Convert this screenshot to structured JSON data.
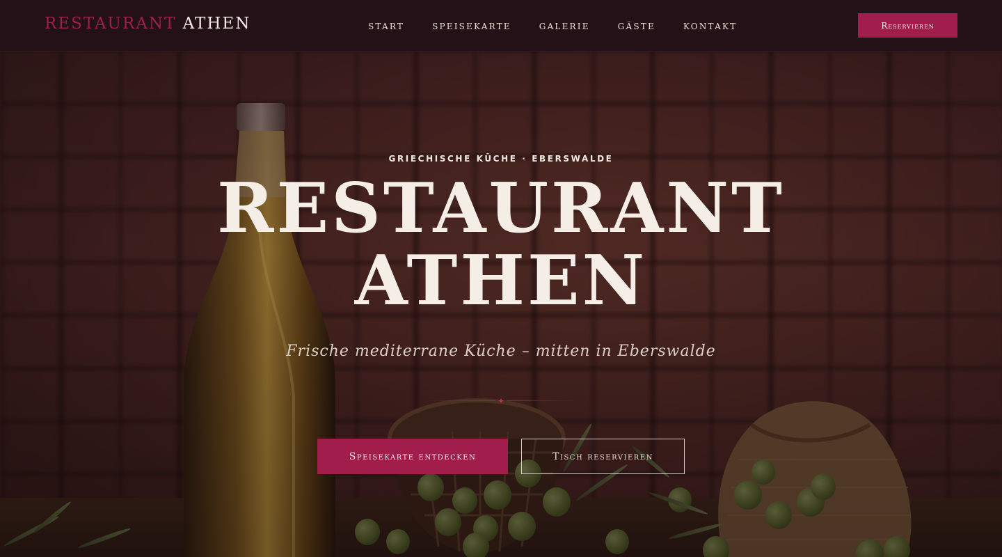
{
  "navbar": {
    "brand_part1": "RESTAURANT",
    "brand_part2": "ATHEN",
    "links": [
      "START",
      "SPEISEKARTE",
      "GALERIE",
      "GÄSTE",
      "KONTAKT"
    ],
    "cta_label": "Reservieren"
  },
  "hero": {
    "eyebrow": "GRIECHISCHE KÜCHE · EBERSWALDE",
    "title_line1": "RESTAURANT",
    "title_line2": "ATHEN",
    "subtitle": "Frische mediterrane Küche – mitten in Eberswalde",
    "primary_button": "Speisekarte entdecken",
    "secondary_button": "Tisch reservieren"
  },
  "colors": {
    "accent": "#a11d4c",
    "navbar_bg": "#241117",
    "text_light": "#f4eee6"
  },
  "icons": {
    "divider_ornament": "diamond-icon"
  }
}
